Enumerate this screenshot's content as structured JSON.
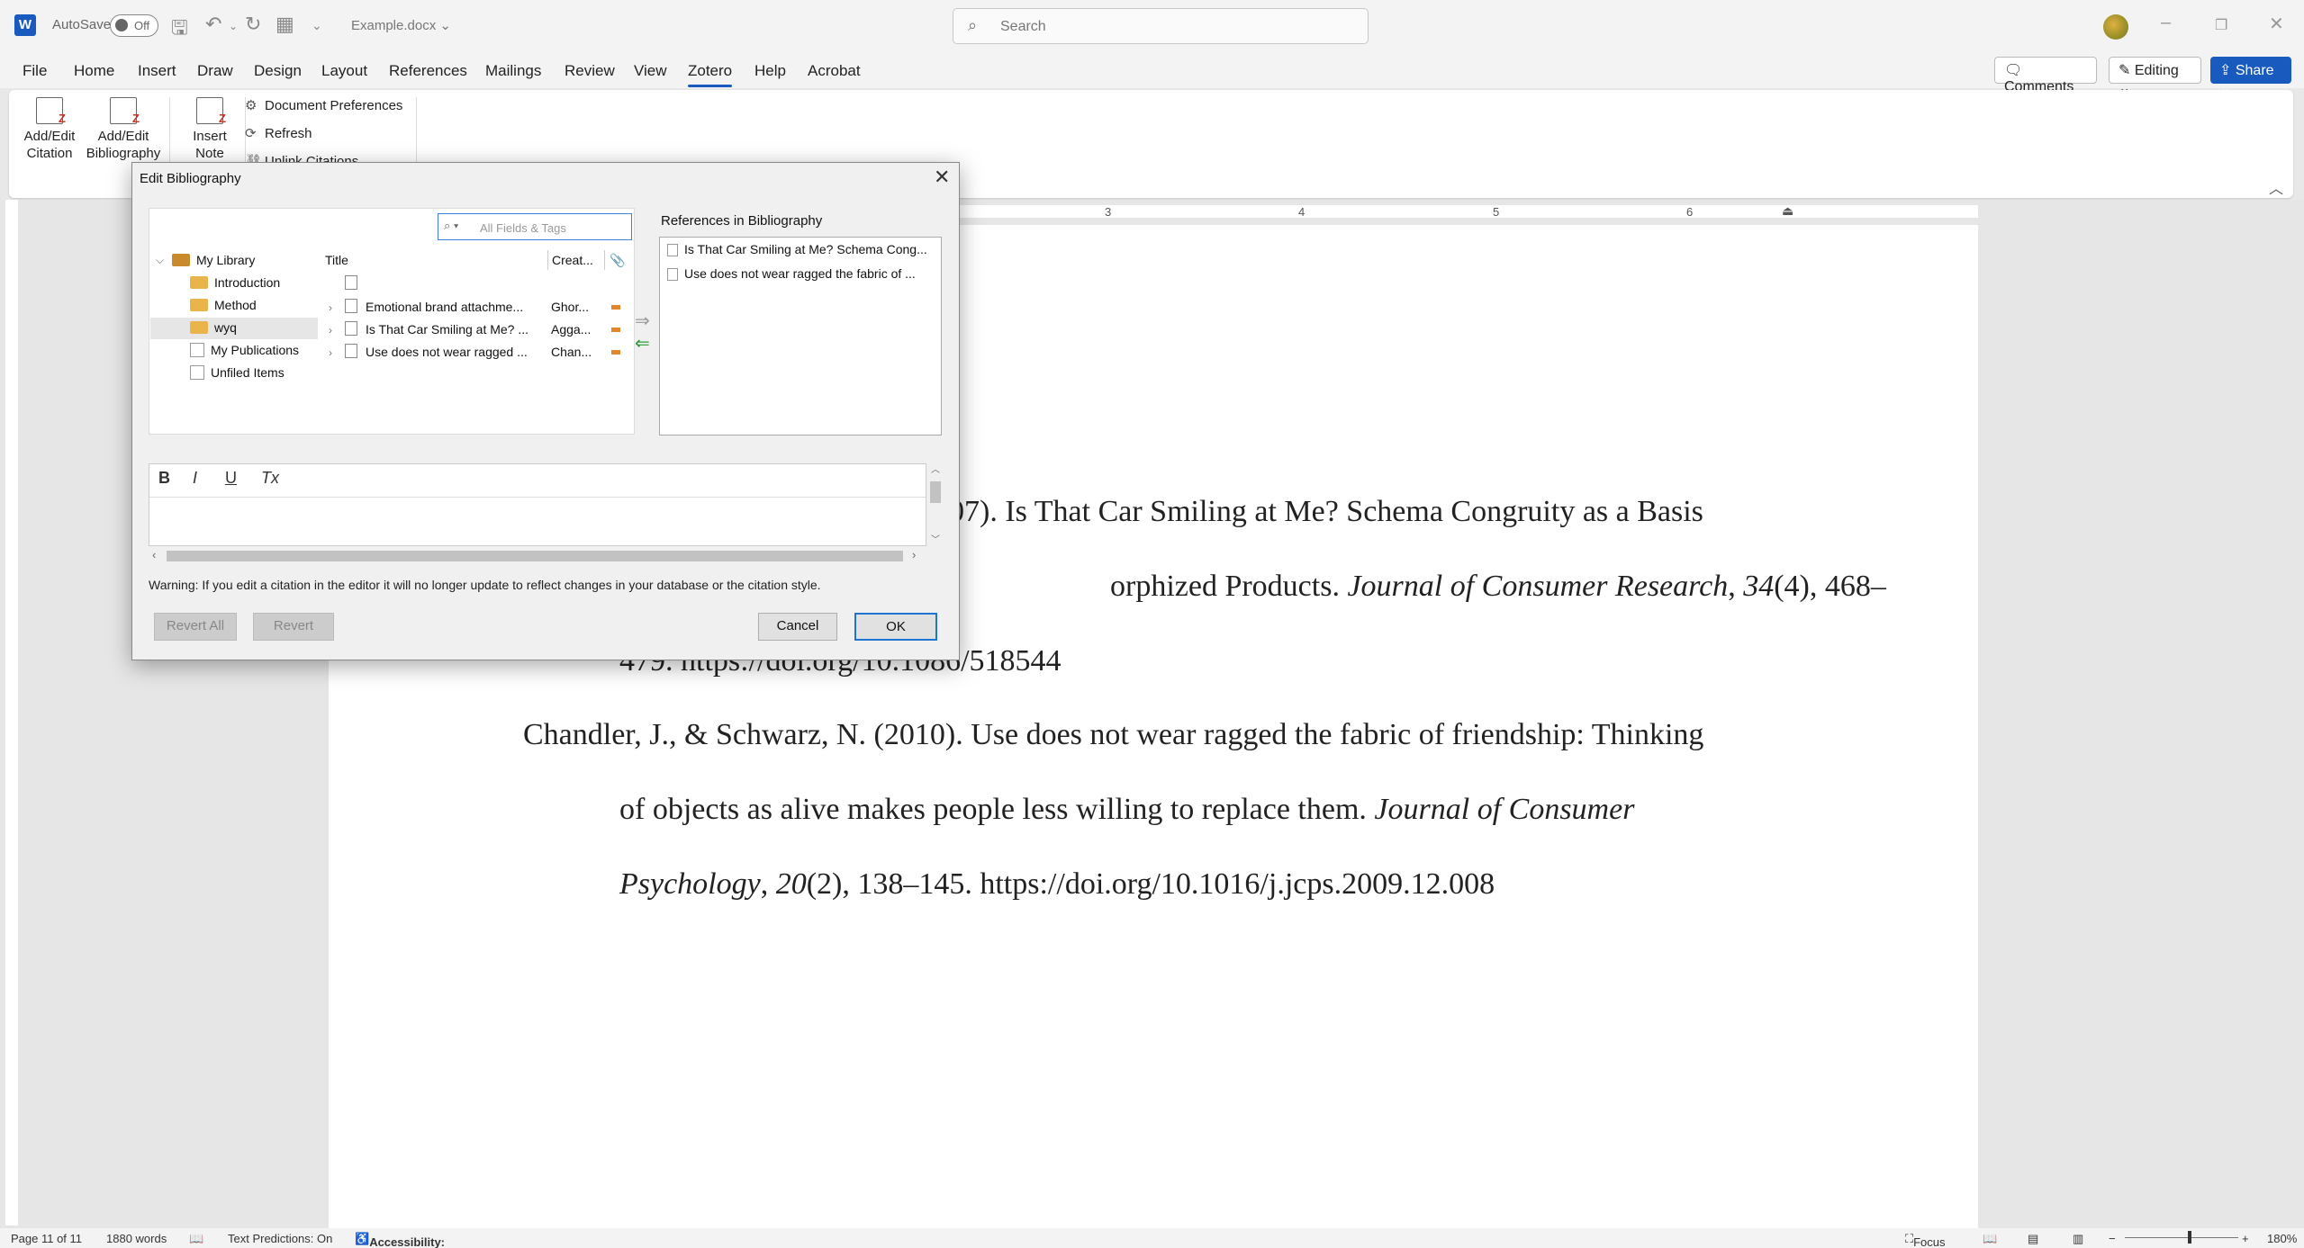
{
  "titlebar": {
    "autosave_label": "AutoSave",
    "autosave_state": "Off",
    "document_name": "Example.docx",
    "search_placeholder": "Search"
  },
  "menu": {
    "tabs": [
      "File",
      "Home",
      "Insert",
      "Draw",
      "Design",
      "Layout",
      "References",
      "Mailings",
      "Review",
      "View",
      "Zotero",
      "Help",
      "Acrobat"
    ],
    "active_tab": "Zotero",
    "comments_label": "Comments",
    "editing_label": "Editing",
    "share_label": "Share"
  },
  "ribbon": {
    "add_edit_citation": [
      "Add/Edit",
      "Citation"
    ],
    "add_edit_bibliography": [
      "Add/Edit",
      "Bibliography"
    ],
    "insert_note": [
      "Insert",
      "Note"
    ],
    "document_preferences": "Document Preferences",
    "refresh": "Refresh",
    "unlink_citations": "Unlink Citations"
  },
  "ruler": {
    "marks": [
      "3",
      "4",
      "5",
      "6"
    ]
  },
  "document": {
    "line1": "007). Is That Car Smiling at Me? Schema Congruity as a Basis",
    "line2_plain": "orphized Products. ",
    "line2_italic": "Journal of Consumer Research",
    "line2_comma": ", ",
    "line2_vol": "34",
    "line2_rest": "(4), 468–",
    "line3": "479. https://doi.org/10.1086/518544",
    "line4": "Chandler, J., & Schwarz, N. (2010). Use does not wear ragged the fabric of friendship: Thinking",
    "line5_plain": "of objects as alive makes people less willing to replace them. ",
    "line5_italic": "Journal of Consumer",
    "line6_italic": "Psychology",
    "line6_comma": ", ",
    "line6_vol": "20",
    "line6_rest": "(2), 138–145. https://doi.org/10.1016/j.jcps.2009.12.008"
  },
  "dialog": {
    "title": "Edit Bibliography",
    "filter_placeholder": "All Fields & Tags",
    "tree": [
      {
        "label": "My Library"
      },
      {
        "label": "Introduction"
      },
      {
        "label": "Method"
      },
      {
        "label": "wyq",
        "selected": true
      },
      {
        "label": "My Publications"
      },
      {
        "label": "Unfiled Items"
      }
    ],
    "columns": {
      "title": "Title",
      "creator": "Creat..."
    },
    "items": [
      {
        "title": "Emotional brand attachme...",
        "creator": "Ghor..."
      },
      {
        "title": "Is That Car Smiling at Me? ...",
        "creator": "Agga..."
      },
      {
        "title": "Use does not wear ragged ...",
        "creator": "Chan..."
      }
    ],
    "refs_label": "References in Bibliography",
    "refs": [
      "Is That Car Smiling at Me? Schema Cong...",
      "Use does not wear ragged the fabric of ..."
    ],
    "format_buttons": [
      "B",
      "I",
      "U",
      "Tx"
    ],
    "warning": "Warning: If you edit a citation in the editor it will no longer update to reflect changes in your database or the citation style.",
    "revert_all": "Revert All",
    "revert": "Revert",
    "cancel": "Cancel",
    "ok": "OK"
  },
  "statusbar": {
    "page": "Page 11 of 11",
    "words": "1880 words",
    "text_predictions": "Text Predictions: On",
    "accessibility": "Accessibility: Investigate",
    "focus": "Focus",
    "zoom": "180%"
  },
  "colors": {
    "accent": "#185abd",
    "ok_border": "#1e74d0",
    "folder": "#e9b44a"
  }
}
